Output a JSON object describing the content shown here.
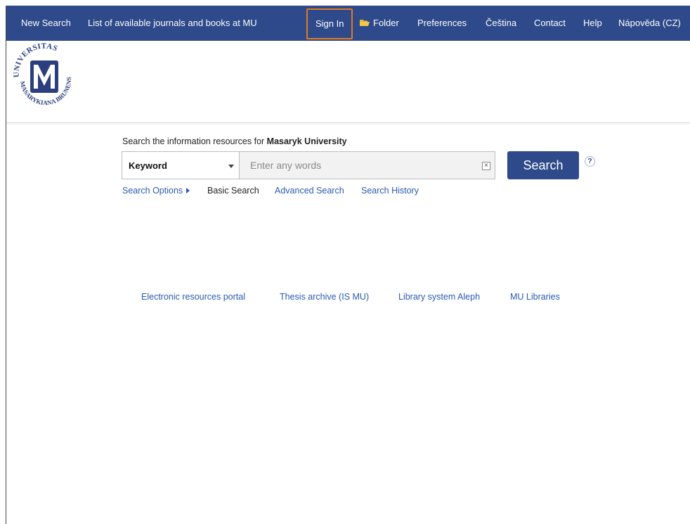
{
  "nav": {
    "new_search": "New Search",
    "journals_list": "List of available journals and books at MU",
    "sign_in": "Sign In",
    "folder": "Folder",
    "preferences": "Preferences",
    "language": "Čeština",
    "contact": "Contact",
    "help": "Help",
    "help_cz": "Nápověda (CZ)",
    "highlight_color": "#e07a20",
    "bar_color": "#2e4a8a"
  },
  "logo": {
    "text_top": "UNIVERSITAS",
    "text_bottom": "MASARYKIANA BRUNENSIS",
    "monogram": "M"
  },
  "search": {
    "intro": "Search the information resources for ",
    "intro_bold": "Masaryk University",
    "field_selected": "Keyword",
    "placeholder": "Enter any words",
    "value": "",
    "clear_symbol": "×",
    "button_label": "Search",
    "help_symbol": "?"
  },
  "options": {
    "search_options": "Search Options",
    "basic_search": "Basic Search",
    "advanced_search": "Advanced Search",
    "search_history": "Search History"
  },
  "footer_links": {
    "eresources": "Electronic resources portal",
    "thesis": "Thesis archive (IS MU)",
    "aleph": "Library system Aleph",
    "libraries": "MU Libraries"
  }
}
